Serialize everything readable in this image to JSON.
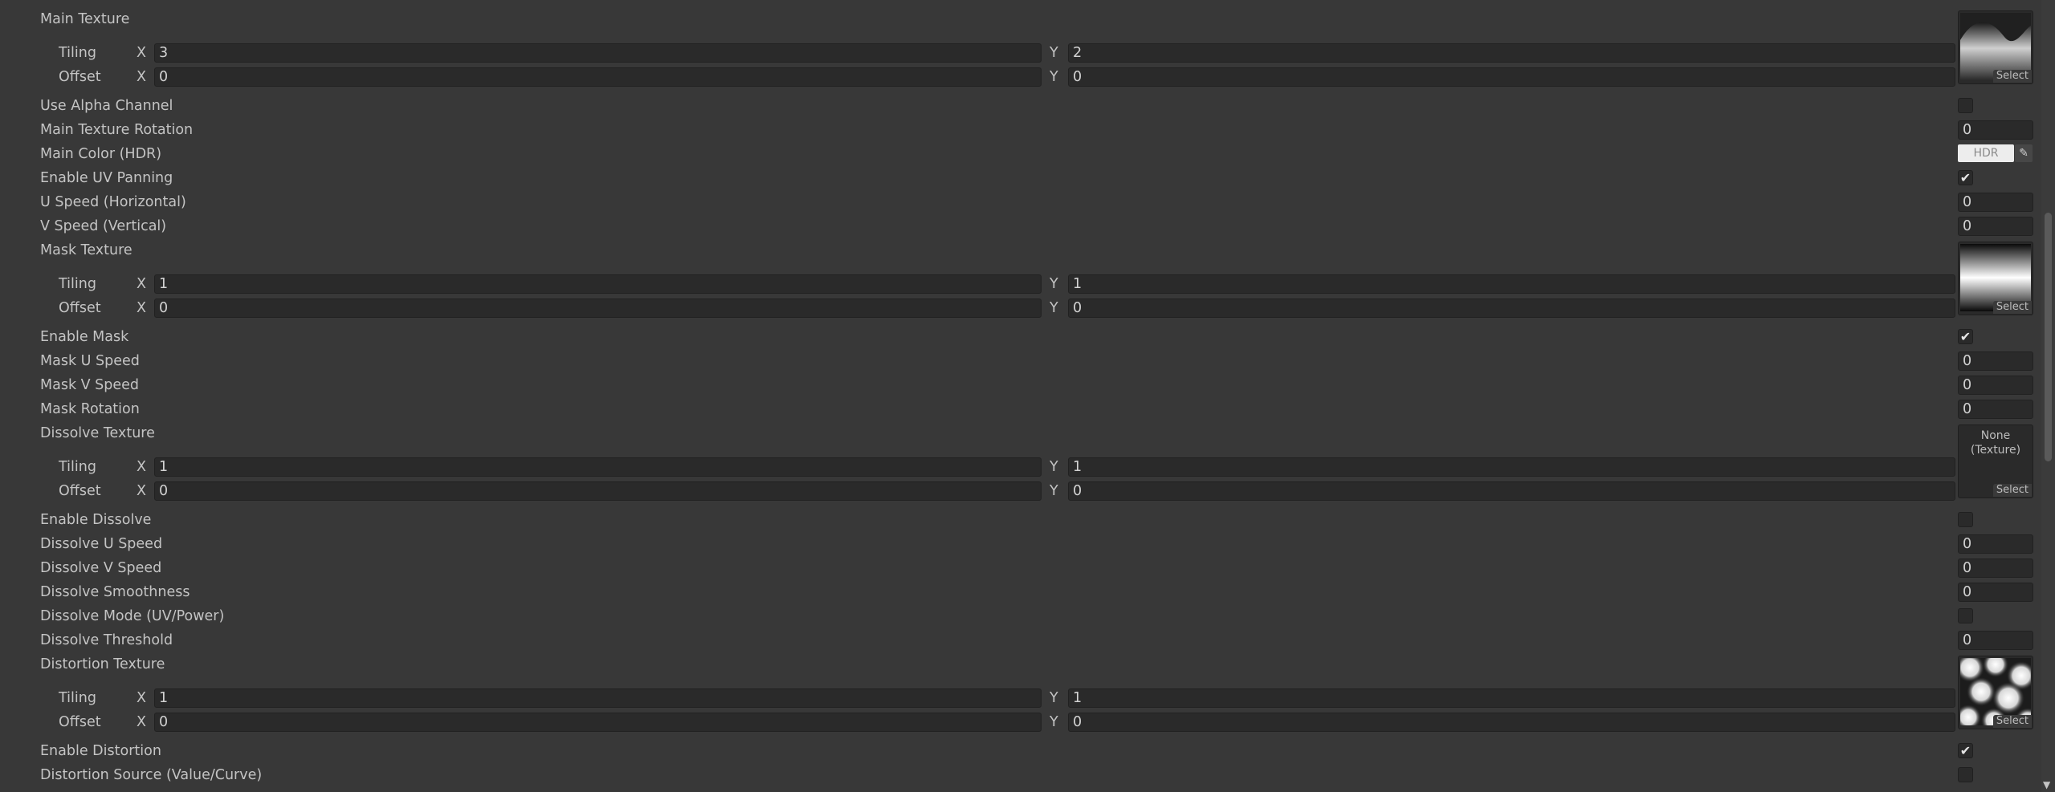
{
  "main": {
    "main_texture": {
      "label": "Main Texture",
      "tiling_label": "Tiling",
      "offset_label": "Offset",
      "tiling_x": "3",
      "tiling_y": "2",
      "offset_x": "0",
      "offset_y": "0",
      "select_label": "Select"
    },
    "use_alpha_channel": {
      "label": "Use Alpha Channel",
      "checked": false
    },
    "main_texture_rotation": {
      "label": "Main Texture Rotation",
      "value": "0"
    },
    "main_color": {
      "label": "Main Color (HDR)",
      "hdr_label": "HDR",
      "color": "#ededed"
    },
    "enable_uv_panning": {
      "label": "Enable UV Panning",
      "checked": true
    },
    "u_speed": {
      "label": "U Speed (Horizontal)",
      "value": "0"
    },
    "v_speed": {
      "label": "V Speed (Vertical)",
      "value": "0"
    },
    "mask_texture": {
      "label": "Mask Texture",
      "tiling_label": "Tiling",
      "offset_label": "Offset",
      "tiling_x": "1",
      "tiling_y": "1",
      "offset_x": "0",
      "offset_y": "0",
      "select_label": "Select"
    },
    "enable_mask": {
      "label": "Enable Mask",
      "checked": true
    },
    "mask_u_speed": {
      "label": "Mask U Speed",
      "value": "0"
    },
    "mask_v_speed": {
      "label": "Mask V Speed",
      "value": "0"
    },
    "mask_rotation": {
      "label": "Mask Rotation",
      "value": "0"
    },
    "dissolve_texture": {
      "label": "Dissolve Texture",
      "tiling_label": "Tiling",
      "offset_label": "Offset",
      "tiling_x": "1",
      "tiling_y": "1",
      "offset_x": "0",
      "offset_y": "0",
      "none_label": "None\n(Texture)",
      "select_label": "Select"
    },
    "enable_dissolve": {
      "label": "Enable Dissolve",
      "checked": false
    },
    "dissolve_u_speed": {
      "label": "Dissolve U Speed",
      "value": "0"
    },
    "dissolve_v_speed": {
      "label": "Dissolve V Speed",
      "value": "0"
    },
    "dissolve_smoothness": {
      "label": "Dissolve Smoothness",
      "value": "0"
    },
    "dissolve_mode": {
      "label": "Dissolve Mode (UV/Power)",
      "checked": false
    },
    "dissolve_threshold": {
      "label": "Dissolve Threshold",
      "value": "0"
    },
    "distortion_texture": {
      "label": "Distortion Texture",
      "tiling_label": "Tiling",
      "offset_label": "Offset",
      "tiling_x": "1",
      "tiling_y": "1",
      "offset_x": "0",
      "offset_y": "0",
      "select_label": "Select"
    },
    "enable_distortion": {
      "label": "Enable Distortion",
      "checked": true
    },
    "distortion_source": {
      "label": "Distortion Source (Value/Curve)",
      "checked": false
    }
  },
  "axis": {
    "x": "X",
    "y": "Y"
  },
  "glyphs": {
    "check": "✔",
    "eyedropper": "✎",
    "scroll_down": "▼"
  }
}
